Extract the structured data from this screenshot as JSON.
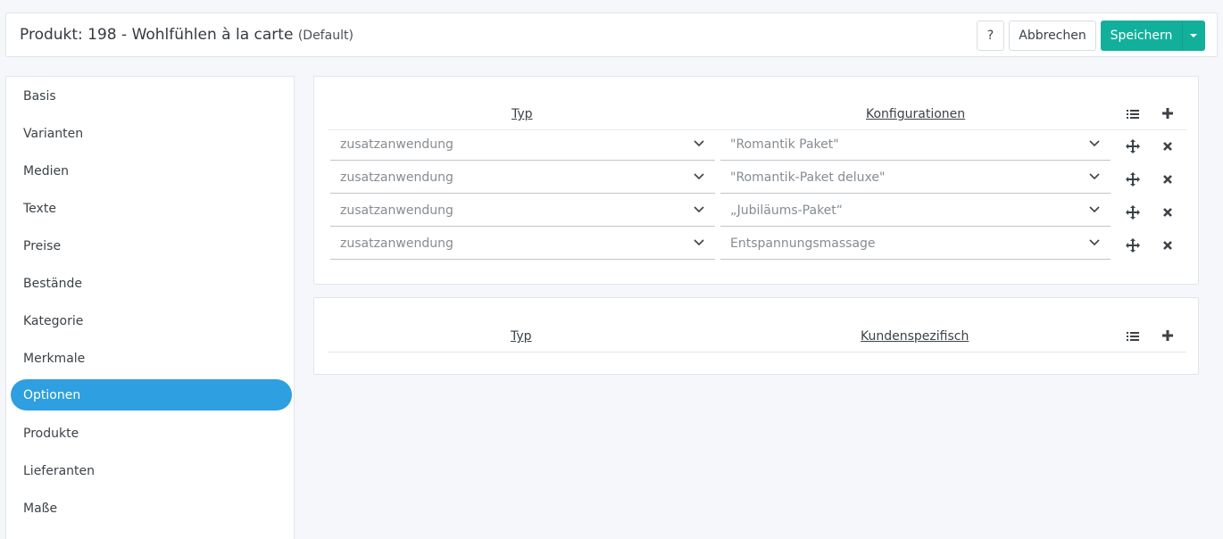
{
  "header": {
    "title": "Produkt: 198 - Wohlfühlen à la carte",
    "subtitle": "(Default)",
    "help_label": "?",
    "cancel_label": "Abbrechen",
    "save_label": "Speichern"
  },
  "sidebar": {
    "items": [
      {
        "label": "Basis"
      },
      {
        "label": "Varianten"
      },
      {
        "label": "Medien"
      },
      {
        "label": "Texte"
      },
      {
        "label": "Preise"
      },
      {
        "label": "Bestände"
      },
      {
        "label": "Kategorie"
      },
      {
        "label": "Merkmale"
      },
      {
        "label": "Optionen",
        "active": true
      },
      {
        "label": "Produkte"
      },
      {
        "label": "Lieferanten"
      },
      {
        "label": "Maße"
      }
    ]
  },
  "configurations": {
    "col_type": "Typ",
    "col_config": "Konfigurationen",
    "rows": [
      {
        "type": "zusatzanwendung",
        "config": "\"Romantik Paket\""
      },
      {
        "type": "zusatzanwendung",
        "config": "\"Romantik-Paket deluxe\""
      },
      {
        "type": "zusatzanwendung",
        "config": "„Jubiläums-Paket“"
      },
      {
        "type": "zusatzanwendung",
        "config": "Entspannungsmassage"
      }
    ]
  },
  "custom": {
    "col_type": "Typ",
    "col_custom": "Kundenspezifisch"
  },
  "icons": {
    "list": "list-icon",
    "add": "plus-icon",
    "move": "move-icon",
    "remove": "close-icon",
    "dropdown": "chevron-down-icon"
  },
  "colors": {
    "accent": "#2e9fe0",
    "save": "#12b09b"
  }
}
